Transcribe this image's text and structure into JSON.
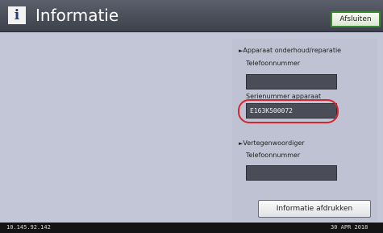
{
  "header": {
    "icon": "info-icon",
    "icon_glyph": "i",
    "title": "Informatie",
    "close_label": "Afsluiten"
  },
  "maintenance": {
    "heading": "Apparaat onderhoud/reparatie",
    "phone_label": "Telefoonnummer",
    "phone_value": "",
    "serial_label": "Serienummer apparaat",
    "serial_value": "E163K500072"
  },
  "representative": {
    "heading": "Vertegenwoordiger",
    "phone_label": "Telefoonnummer",
    "phone_value": ""
  },
  "print_label": "Informatie afdrukken",
  "footer": {
    "ip": "10.145.92.142",
    "date": "30 APR  2018"
  },
  "colors": {
    "accent_green": "#3b8a2e",
    "highlight_red": "#d8262e"
  }
}
